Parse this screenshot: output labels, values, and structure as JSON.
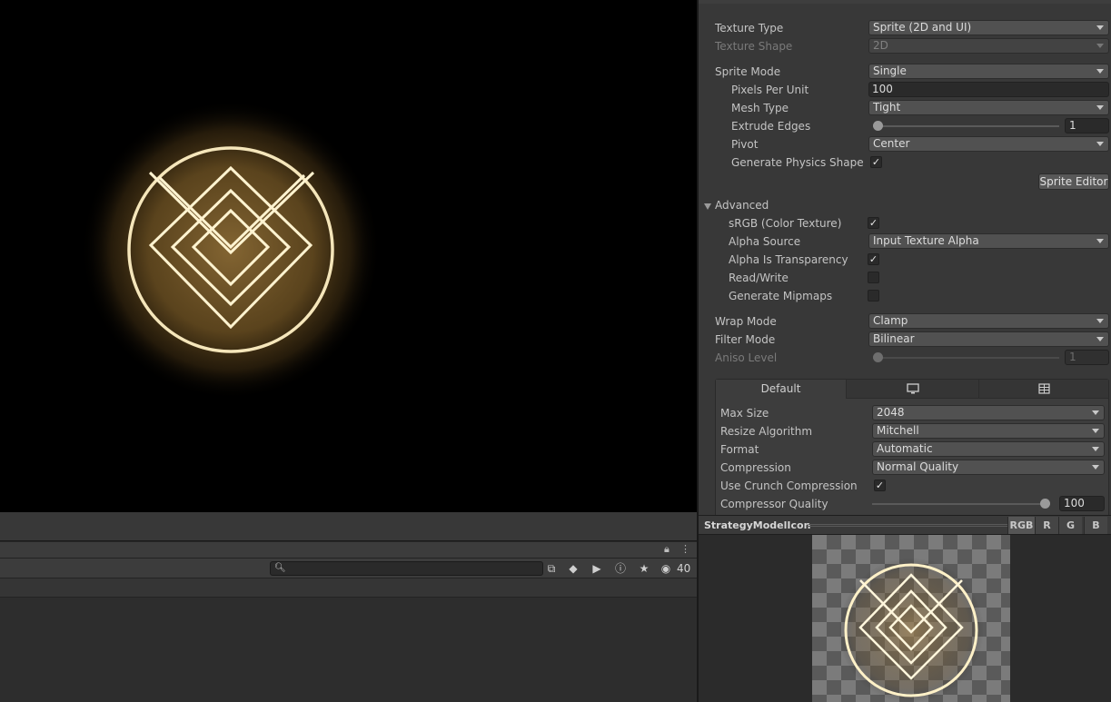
{
  "scene": {
    "name": ""
  },
  "project": {
    "search": {
      "value": "",
      "placeholder": ""
    },
    "hidden_count": "40"
  },
  "inspector": {
    "texture_type": {
      "label": "Texture Type",
      "value": "Sprite (2D and UI)"
    },
    "texture_shape": {
      "label": "Texture Shape",
      "value": "2D"
    },
    "sprite_mode": {
      "label": "Sprite Mode",
      "value": "Single"
    },
    "pixels_per_unit": {
      "label": "Pixels Per Unit",
      "value": "100"
    },
    "mesh_type": {
      "label": "Mesh Type",
      "value": "Tight"
    },
    "extrude_edges": {
      "label": "Extrude Edges",
      "value": "1",
      "fraction": 0.0
    },
    "pivot": {
      "label": "Pivot",
      "value": "Center"
    },
    "generate_physics_shape": {
      "label": "Generate Physics Shape",
      "checked": true
    },
    "sprite_editor_button": "Sprite Editor",
    "advanced": {
      "label": "Advanced",
      "srgb": {
        "label": "sRGB (Color Texture)",
        "checked": true
      },
      "alpha_source": {
        "label": "Alpha Source",
        "value": "Input Texture Alpha"
      },
      "alpha_is_transparency": {
        "label": "Alpha Is Transparency",
        "checked": true
      },
      "read_write": {
        "label": "Read/Write",
        "checked": false
      },
      "generate_mipmaps": {
        "label": "Generate Mipmaps",
        "checked": false
      }
    },
    "wrap_mode": {
      "label": "Wrap Mode",
      "value": "Clamp"
    },
    "filter_mode": {
      "label": "Filter Mode",
      "value": "Bilinear"
    },
    "aniso_level": {
      "label": "Aniso Level",
      "value": "1",
      "fraction": 0.0
    },
    "platform_tabs": [
      {
        "label": "Default",
        "icon": ""
      },
      {
        "label": "",
        "icon": "monitor-icon"
      },
      {
        "label": "",
        "icon": "grid-icon"
      }
    ],
    "platform": {
      "max_size": {
        "label": "Max Size",
        "value": "2048"
      },
      "resize_algorithm": {
        "label": "Resize Algorithm",
        "value": "Mitchell"
      },
      "format": {
        "label": "Format",
        "value": "Automatic"
      },
      "compression": {
        "label": "Compression",
        "value": "Normal Quality"
      },
      "use_crunch": {
        "label": "Use Crunch Compression",
        "checked": true
      },
      "compressor_quality": {
        "label": "Compressor Quality",
        "value": "100",
        "fraction": 1.0
      }
    }
  },
  "preview": {
    "title": "StrategyModelIcon",
    "channels": [
      "RGB",
      "R",
      "G",
      "B"
    ]
  },
  "colors": {
    "glow": "#c89a4a",
    "rune": "#fff2c8",
    "bg": "#383838"
  }
}
